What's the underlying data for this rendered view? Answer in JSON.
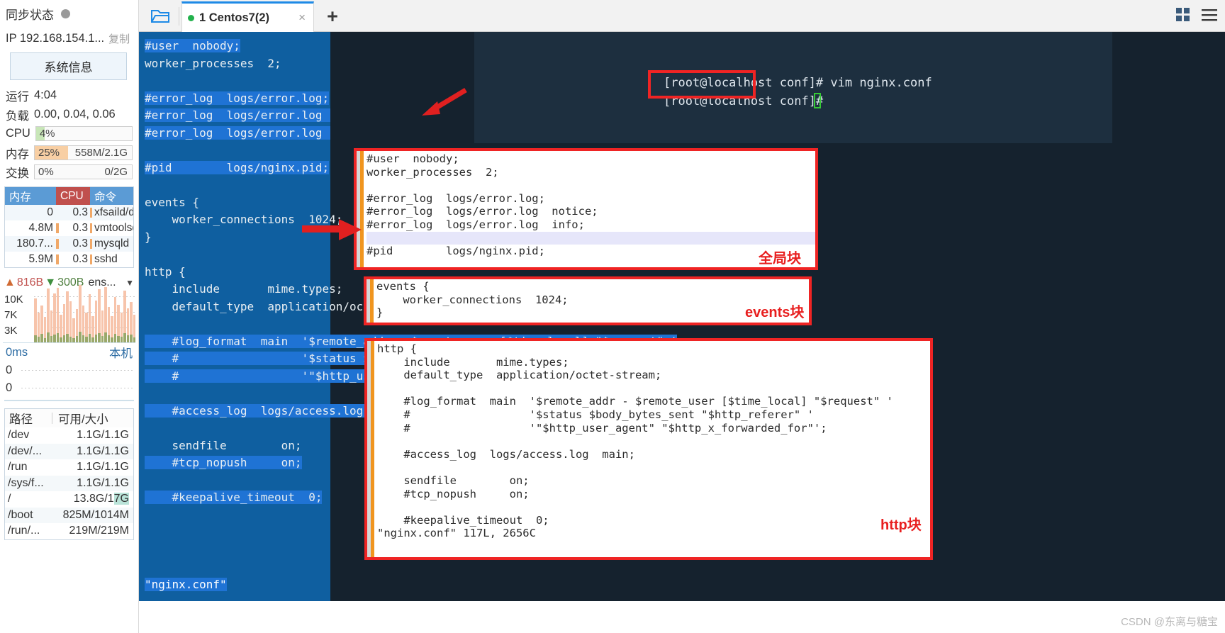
{
  "sidebar": {
    "sync": {
      "label": "同步状态",
      "status_color": "#9a9a9a"
    },
    "ip": {
      "label": "IP 192.168.154.1...",
      "copy_label": "复制"
    },
    "sysinfo_button": "系统信息",
    "uptime": {
      "key": "运行",
      "value": "4:04"
    },
    "load": {
      "key": "负载",
      "value": "0.00, 0.04, 0.06"
    },
    "cpu": {
      "key": "CPU",
      "percent": "4%",
      "fill_pct": 9,
      "fill_color": "#c8e6b8"
    },
    "memory": {
      "key": "内存",
      "percent": "25%",
      "detail": "558M/2.1G",
      "fill_pct": 34,
      "fill_color": "#f8cfa4"
    },
    "swap": {
      "key": "交换",
      "percent": "0%",
      "detail": "0/2G",
      "fill_pct": 0,
      "fill_color": "#e6e6e6"
    },
    "process_table": {
      "headers": [
        "内存",
        "CPU",
        "命令"
      ],
      "header_colors": {
        "mem": "#5b9bd5",
        "cpu": "#c0504d",
        "cmd": "#5b9bd5"
      },
      "rows": [
        {
          "mem": "0",
          "cpu": "0.3",
          "cmd": "xfsaild/d",
          "membar": 0
        },
        {
          "mem": "4.8M",
          "cpu": "0.3",
          "cmd": "vmtoolsd",
          "membar": 4
        },
        {
          "mem": "180.7...",
          "cpu": "0.3",
          "cmd": "mysqld",
          "membar": 14
        },
        {
          "mem": "5.9M",
          "cpu": "0.3",
          "cmd": "sshd",
          "membar": 4
        }
      ]
    },
    "network": {
      "up_value": "816B",
      "down_value": "300B",
      "interface": "ens...",
      "y_labels": [
        "10K",
        "7K",
        "3K"
      ]
    },
    "latency": {
      "value": "0ms",
      "host_label": "本机",
      "rows": [
        "0",
        "0"
      ]
    },
    "disk_table": {
      "headers": [
        "路径",
        "可用/大小"
      ],
      "rows": [
        {
          "path": "/dev",
          "size": "1.1G/1.1G",
          "hl": ""
        },
        {
          "path": "/dev/...",
          "size": "1.1G/1.1G",
          "hl": ""
        },
        {
          "path": "/run",
          "size": "1.1G/1.1G",
          "hl": ""
        },
        {
          "path": "/sys/f...",
          "size": "1.1G/1.1G",
          "hl": ""
        },
        {
          "path": "/",
          "size": "13.8G/1",
          "hl": "7G"
        },
        {
          "path": "/boot",
          "size": "825M/1014M",
          "hl": ""
        },
        {
          "path": "/run/...",
          "size": "219M/219M",
          "hl": ""
        }
      ]
    }
  },
  "tabbar": {
    "folder_icon": "folder-icon",
    "tab": {
      "label": "1 Centos7(2)",
      "status_color": "#22b14c",
      "close_label": "×"
    },
    "add_label": "+",
    "grid_icon": "grid-icon",
    "menu_icon": "hamburger-menu-icon"
  },
  "console": {
    "line1_prefix": "[root@localhost conf]# vim ",
    "line1_highlight": "nginx.conf",
    "line2": "[root@localhost conf]# "
  },
  "vim_background": {
    "lines": [
      "#user  nobody;",
      "worker_processes  2;",
      "",
      "#error_log  logs/error.log;",
      "#error_log  logs/error.log  notice;",
      "#error_log  logs/error.log  info;",
      "",
      "#pid        logs/nginx.pid;",
      "",
      "events {",
      "    worker_connections  1024;",
      "}",
      "",
      "http {",
      "    include       mime.types;",
      "    default_type  application/octet-stream;",
      "",
      "    #log_format  main  '$remote_addr - $remote_user [$time_local] \"$request\" '",
      "    #                  '$status $body_bytes_sent \"$http_referer\" '",
      "    #                  '\"$http_user_agent\" \"$http_x_forwarded_for\"';",
      "",
      "    #access_log  logs/access.log  main;",
      "",
      "    sendfile        on;",
      "    #tcp_nopush     on;",
      "",
      "    #keepalive_timeout  0;"
    ],
    "status": "\"nginx.conf\""
  },
  "panels": {
    "global_block": {
      "tag": "全局块",
      "lines": [
        "#user  nobody;",
        "worker_processes  2;",
        "",
        "#error_log  logs/error.log;",
        "#error_log  logs/error.log  notice;",
        "#error_log  logs/error.log  info;",
        "",
        "#pid        logs/nginx.pid;"
      ],
      "highlight_line_index": 6
    },
    "events_block": {
      "tag": "events块",
      "lines": [
        "events {",
        "    worker_connections  1024;",
        "}"
      ]
    },
    "http_block": {
      "tag": "http块",
      "lines": [
        "http {",
        "    include       mime.types;",
        "    default_type  application/octet-stream;",
        "",
        "    #log_format  main  '$remote_addr - $remote_user [$time_local] \"$request\" '",
        "    #                  '$status $body_bytes_sent \"$http_referer\" '",
        "    #                  '\"$http_user_agent\" \"$http_x_forwarded_for\"';",
        "",
        "    #access_log  logs/access.log  main;",
        "",
        "    sendfile        on;",
        "    #tcp_nopush     on;",
        "",
        "    #keepalive_timeout  0;",
        "\"nginx.conf\" 117L, 2656C"
      ]
    }
  },
  "annotations": {
    "box_color": "#ef2424",
    "arrow_color": "#e02020"
  },
  "watermark": "CSDN @东离与糖宝"
}
